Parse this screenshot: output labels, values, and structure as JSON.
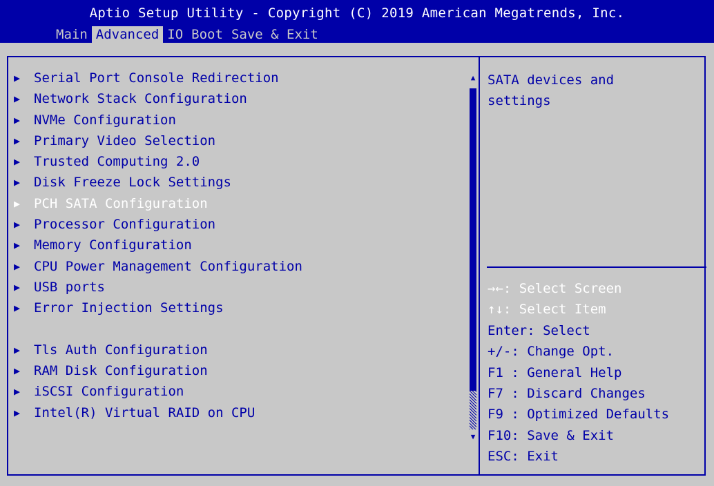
{
  "header": {
    "title": "Aptio Setup Utility - Copyright (C) 2019 American Megatrends, Inc.",
    "tabs": [
      {
        "label": "Main",
        "active": false
      },
      {
        "label": "Advanced",
        "active": true
      },
      {
        "label": "IO",
        "active": false
      },
      {
        "label": "Boot",
        "active": false
      },
      {
        "label": "Save & Exit",
        "active": false
      }
    ]
  },
  "menu": {
    "items": [
      {
        "label": "Serial Port Console Redirection"
      },
      {
        "label": "Network Stack Configuration"
      },
      {
        "label": "NVMe Configuration"
      },
      {
        "label": "Primary Video Selection"
      },
      {
        "label": "Trusted Computing 2.0"
      },
      {
        "label": "Disk Freeze Lock Settings"
      },
      {
        "label": "PCH SATA Configuration",
        "selected": true
      },
      {
        "label": "Processor Configuration"
      },
      {
        "label": "Memory Configuration"
      },
      {
        "label": "CPU Power Management Configuration"
      },
      {
        "label": "USB ports"
      },
      {
        "label": "Error Injection Settings"
      },
      {
        "label": "",
        "gap": true
      },
      {
        "label": "Tls Auth Configuration"
      },
      {
        "label": "RAM Disk Configuration"
      },
      {
        "label": "iSCSI Configuration"
      },
      {
        "label": "Intel(R) Virtual RAID on CPU"
      }
    ],
    "submenu_arrow": "▶"
  },
  "scrollbar": {
    "up_arrow": "▲",
    "down_arrow": "▼"
  },
  "help": {
    "text_lines": [
      "SATA devices and",
      "settings"
    ],
    "keys": [
      {
        "text": "→←: Select Screen",
        "highlight": true
      },
      {
        "text": "↑↓: Select Item",
        "highlight": true
      },
      {
        "text": "Enter: Select",
        "highlight": false
      },
      {
        "text": "+/-: Change Opt.",
        "highlight": false
      },
      {
        "text": "F1 : General Help",
        "highlight": false
      },
      {
        "text": "F7 : Discard Changes",
        "highlight": false
      },
      {
        "text": "F9 : Optimized Defaults",
        "highlight": false
      },
      {
        "text": "F10: Save & Exit",
        "highlight": false
      },
      {
        "text": "ESC: Exit",
        "highlight": false
      }
    ]
  },
  "colors": {
    "background": "#c8c8c8",
    "accent": "#0000a8",
    "highlight": "#ffffff"
  }
}
